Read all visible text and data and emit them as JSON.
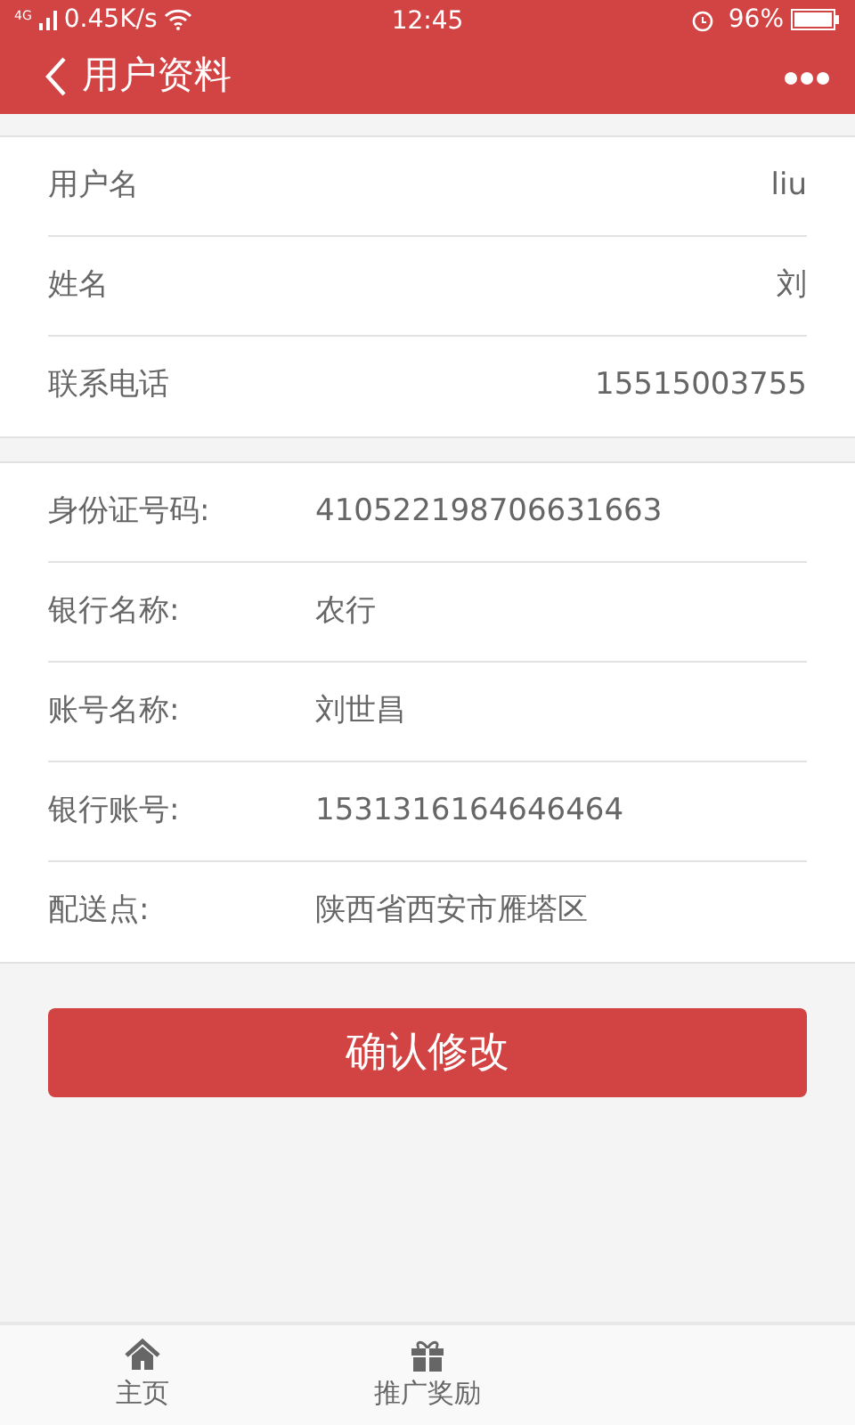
{
  "status_bar": {
    "network": "4G",
    "speed": "0.45K/s",
    "time": "12:45",
    "battery": "96%"
  },
  "header": {
    "title": "用户资料"
  },
  "account_section": [
    {
      "label": "用户名",
      "value": "liu"
    },
    {
      "label": "姓名",
      "value": "刘"
    },
    {
      "label": "联系电话",
      "value": "15515003755"
    }
  ],
  "detail_section": [
    {
      "label": "身份证号码:",
      "value": "410522198706631663"
    },
    {
      "label": "银行名称:",
      "value": "农行"
    },
    {
      "label": "账号名称:",
      "value": "刘世昌"
    },
    {
      "label": "银行账号:",
      "value": "1531316164646464"
    },
    {
      "label": "配送点:",
      "value": "陕西省西安市雁塔区"
    }
  ],
  "confirm_button": "确认修改",
  "bottom_nav": [
    {
      "label": "主页",
      "kind": "home"
    },
    {
      "label": "推广奖励",
      "kind": "gift"
    }
  ]
}
